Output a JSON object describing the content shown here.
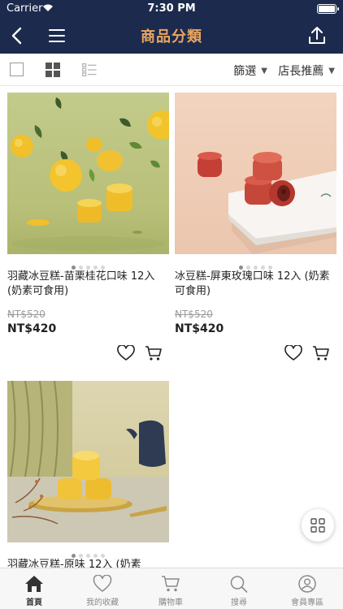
{
  "status_bar": {
    "carrier": "Carrier",
    "time": "7:30 PM"
  },
  "nav": {
    "title": "商品分類"
  },
  "toolbar": {
    "filter_label": "篩選",
    "sort_label": "店長推薦"
  },
  "products": [
    {
      "name": "羽藏冰豆糕-苗栗桂花口味 12入 (奶素可食用)",
      "original_price": "NT$520",
      "price": "NT$420",
      "image_pages": 5,
      "active_page": 1
    },
    {
      "name": "冰豆糕-屏東玫瑰口味 12入 (奶素可食用)",
      "original_price": "NT$520",
      "price": "NT$420",
      "image_pages": 5,
      "active_page": 1
    },
    {
      "name": "羽藏冰豆糕-原味 12入 (奶素",
      "image_pages": 5,
      "active_page": 1
    }
  ],
  "tabs": [
    {
      "label": "首頁",
      "icon": "home-icon",
      "active": true
    },
    {
      "label": "我的收藏",
      "icon": "heart-icon",
      "active": false
    },
    {
      "label": "購物車",
      "icon": "cart-icon",
      "active": false
    },
    {
      "label": "搜尋",
      "icon": "search-icon",
      "active": false
    },
    {
      "label": "會員專區",
      "icon": "user-icon",
      "active": false
    }
  ],
  "colors": {
    "nav_bg": "#1c2a4d",
    "title": "#e9a55f",
    "tab_active": "#333333"
  }
}
